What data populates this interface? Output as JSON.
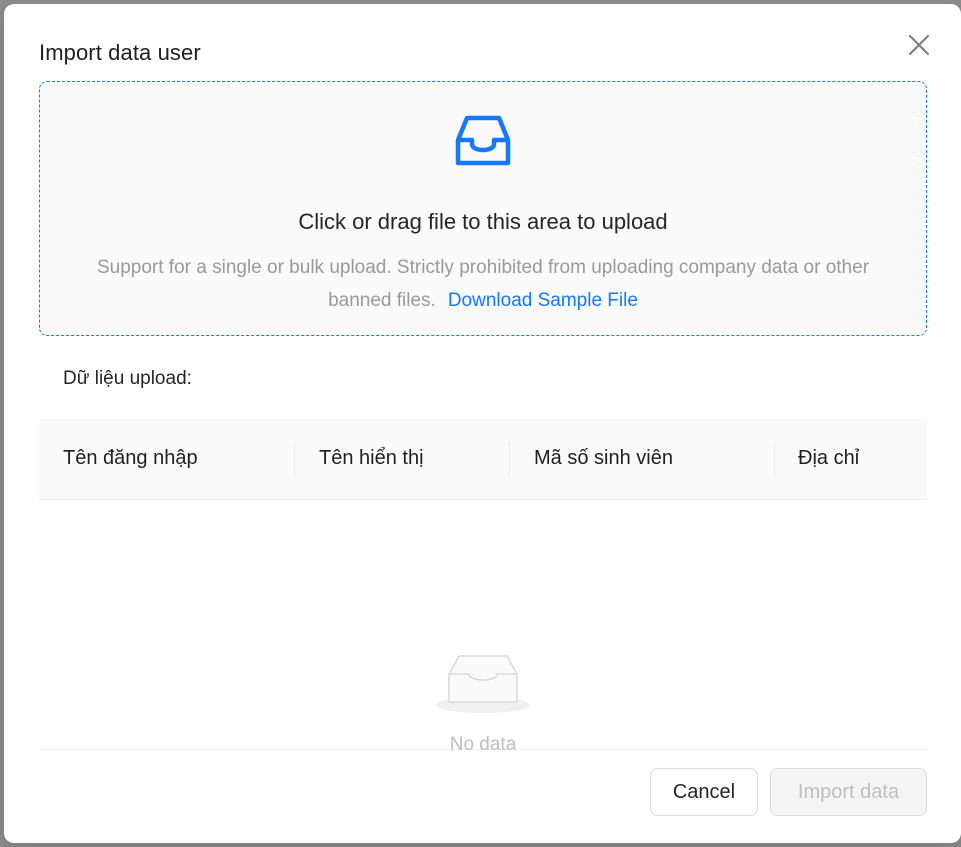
{
  "modal": {
    "title": "Import data user",
    "close_icon": "close-icon"
  },
  "dropzone": {
    "icon": "inbox-icon",
    "accent_color": "#1677ff",
    "text": "Click or drag file to this area to upload",
    "hint_line1": "Support for a single or bulk upload. Strictly prohibited from uploading company data or other",
    "hint_line2": "banned files.",
    "download_link": "Download Sample File"
  },
  "upload_section": {
    "label": "Dữ liệu upload:"
  },
  "table": {
    "columns": [
      "Tên đăng nhập",
      "Tên hiển thị",
      "Mã số sinh viên",
      "Địa chỉ"
    ],
    "rows": [],
    "empty_icon": "empty-inbox-icon",
    "empty_text": "No data"
  },
  "footer": {
    "cancel_label": "Cancel",
    "import_label": "Import data",
    "import_disabled": true
  }
}
